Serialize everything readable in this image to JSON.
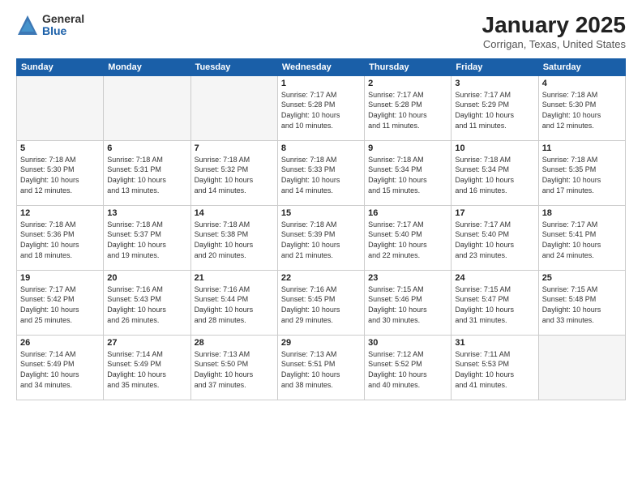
{
  "header": {
    "logo_general": "General",
    "logo_blue": "Blue",
    "month": "January 2025",
    "location": "Corrigan, Texas, United States"
  },
  "days_of_week": [
    "Sunday",
    "Monday",
    "Tuesday",
    "Wednesday",
    "Thursday",
    "Friday",
    "Saturday"
  ],
  "weeks": [
    [
      {
        "day": "",
        "empty": true
      },
      {
        "day": "",
        "empty": true
      },
      {
        "day": "",
        "empty": true
      },
      {
        "day": "1",
        "detail": "Sunrise: 7:17 AM\nSunset: 5:28 PM\nDaylight: 10 hours\nand 10 minutes."
      },
      {
        "day": "2",
        "detail": "Sunrise: 7:17 AM\nSunset: 5:28 PM\nDaylight: 10 hours\nand 11 minutes."
      },
      {
        "day": "3",
        "detail": "Sunrise: 7:17 AM\nSunset: 5:29 PM\nDaylight: 10 hours\nand 11 minutes."
      },
      {
        "day": "4",
        "detail": "Sunrise: 7:18 AM\nSunset: 5:30 PM\nDaylight: 10 hours\nand 12 minutes."
      }
    ],
    [
      {
        "day": "5",
        "detail": "Sunrise: 7:18 AM\nSunset: 5:30 PM\nDaylight: 10 hours\nand 12 minutes."
      },
      {
        "day": "6",
        "detail": "Sunrise: 7:18 AM\nSunset: 5:31 PM\nDaylight: 10 hours\nand 13 minutes."
      },
      {
        "day": "7",
        "detail": "Sunrise: 7:18 AM\nSunset: 5:32 PM\nDaylight: 10 hours\nand 14 minutes."
      },
      {
        "day": "8",
        "detail": "Sunrise: 7:18 AM\nSunset: 5:33 PM\nDaylight: 10 hours\nand 14 minutes."
      },
      {
        "day": "9",
        "detail": "Sunrise: 7:18 AM\nSunset: 5:34 PM\nDaylight: 10 hours\nand 15 minutes."
      },
      {
        "day": "10",
        "detail": "Sunrise: 7:18 AM\nSunset: 5:34 PM\nDaylight: 10 hours\nand 16 minutes."
      },
      {
        "day": "11",
        "detail": "Sunrise: 7:18 AM\nSunset: 5:35 PM\nDaylight: 10 hours\nand 17 minutes."
      }
    ],
    [
      {
        "day": "12",
        "detail": "Sunrise: 7:18 AM\nSunset: 5:36 PM\nDaylight: 10 hours\nand 18 minutes."
      },
      {
        "day": "13",
        "detail": "Sunrise: 7:18 AM\nSunset: 5:37 PM\nDaylight: 10 hours\nand 19 minutes."
      },
      {
        "day": "14",
        "detail": "Sunrise: 7:18 AM\nSunset: 5:38 PM\nDaylight: 10 hours\nand 20 minutes."
      },
      {
        "day": "15",
        "detail": "Sunrise: 7:18 AM\nSunset: 5:39 PM\nDaylight: 10 hours\nand 21 minutes."
      },
      {
        "day": "16",
        "detail": "Sunrise: 7:17 AM\nSunset: 5:40 PM\nDaylight: 10 hours\nand 22 minutes."
      },
      {
        "day": "17",
        "detail": "Sunrise: 7:17 AM\nSunset: 5:40 PM\nDaylight: 10 hours\nand 23 minutes."
      },
      {
        "day": "18",
        "detail": "Sunrise: 7:17 AM\nSunset: 5:41 PM\nDaylight: 10 hours\nand 24 minutes."
      }
    ],
    [
      {
        "day": "19",
        "detail": "Sunrise: 7:17 AM\nSunset: 5:42 PM\nDaylight: 10 hours\nand 25 minutes."
      },
      {
        "day": "20",
        "detail": "Sunrise: 7:16 AM\nSunset: 5:43 PM\nDaylight: 10 hours\nand 26 minutes."
      },
      {
        "day": "21",
        "detail": "Sunrise: 7:16 AM\nSunset: 5:44 PM\nDaylight: 10 hours\nand 28 minutes."
      },
      {
        "day": "22",
        "detail": "Sunrise: 7:16 AM\nSunset: 5:45 PM\nDaylight: 10 hours\nand 29 minutes."
      },
      {
        "day": "23",
        "detail": "Sunrise: 7:15 AM\nSunset: 5:46 PM\nDaylight: 10 hours\nand 30 minutes."
      },
      {
        "day": "24",
        "detail": "Sunrise: 7:15 AM\nSunset: 5:47 PM\nDaylight: 10 hours\nand 31 minutes."
      },
      {
        "day": "25",
        "detail": "Sunrise: 7:15 AM\nSunset: 5:48 PM\nDaylight: 10 hours\nand 33 minutes."
      }
    ],
    [
      {
        "day": "26",
        "detail": "Sunrise: 7:14 AM\nSunset: 5:49 PM\nDaylight: 10 hours\nand 34 minutes."
      },
      {
        "day": "27",
        "detail": "Sunrise: 7:14 AM\nSunset: 5:49 PM\nDaylight: 10 hours\nand 35 minutes."
      },
      {
        "day": "28",
        "detail": "Sunrise: 7:13 AM\nSunset: 5:50 PM\nDaylight: 10 hours\nand 37 minutes."
      },
      {
        "day": "29",
        "detail": "Sunrise: 7:13 AM\nSunset: 5:51 PM\nDaylight: 10 hours\nand 38 minutes."
      },
      {
        "day": "30",
        "detail": "Sunrise: 7:12 AM\nSunset: 5:52 PM\nDaylight: 10 hours\nand 40 minutes."
      },
      {
        "day": "31",
        "detail": "Sunrise: 7:11 AM\nSunset: 5:53 PM\nDaylight: 10 hours\nand 41 minutes."
      },
      {
        "day": "",
        "empty": true
      }
    ]
  ]
}
